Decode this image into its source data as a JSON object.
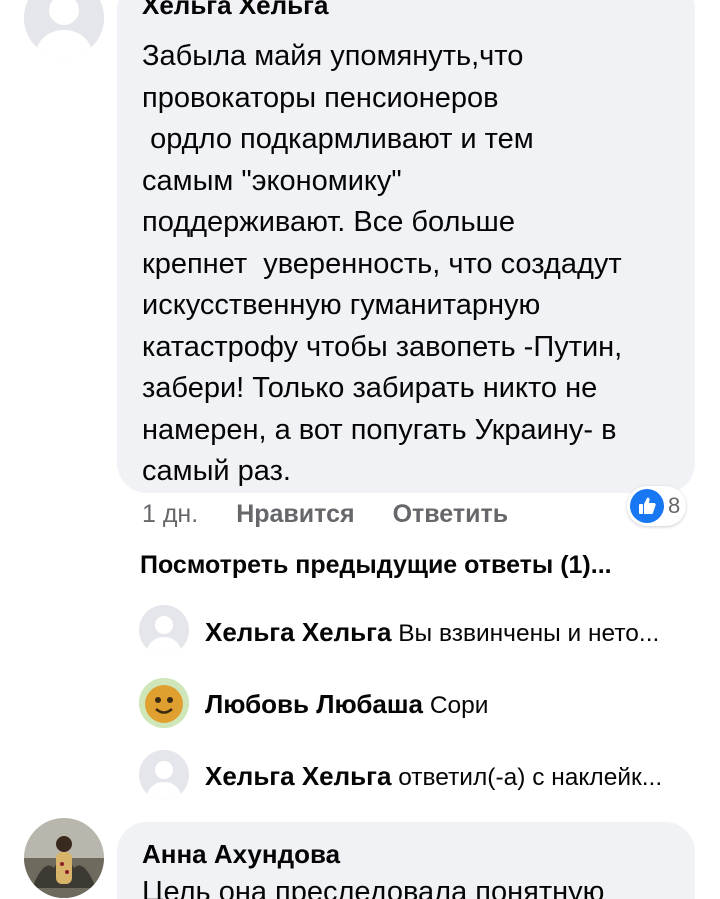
{
  "main_comment": {
    "author": "Хельга Хельга",
    "text": "Забыла майя упомянуть,что\nпровокаторы пенсионеров\n ордло подкармливают и тем\nсамым \"экономику\"\nподдерживают. Все больше\nкрепнет  уверенность, что создадут\nискусственную гуманитарную\nкатастрофу чтобы завопеть -Путин,\nзабери! Только забирать никто не\nнамерен, а вот попугать Украину- в\nсамый раз.",
    "time": "1 дн.",
    "like_label": "Нравится",
    "reply_label": "Ответить",
    "reaction_count": "8"
  },
  "view_previous": "Посмотреть предыдущие ответы (1)...",
  "replies": [
    {
      "author": "Хельга Хельга",
      "text": "Вы взвинчены и нето..."
    },
    {
      "author": "Любовь Любаша",
      "text": "Сори"
    },
    {
      "author": "Хельга Хельга",
      "text": "ответил(-а) с наклейк..."
    }
  ],
  "next_comment": {
    "author": "Анна Ахундова",
    "text": "Цель она преследовала понятную"
  },
  "colors": {
    "accent": "#1877f2",
    "bubble": "#f0f2f5",
    "muted": "#65676b"
  }
}
